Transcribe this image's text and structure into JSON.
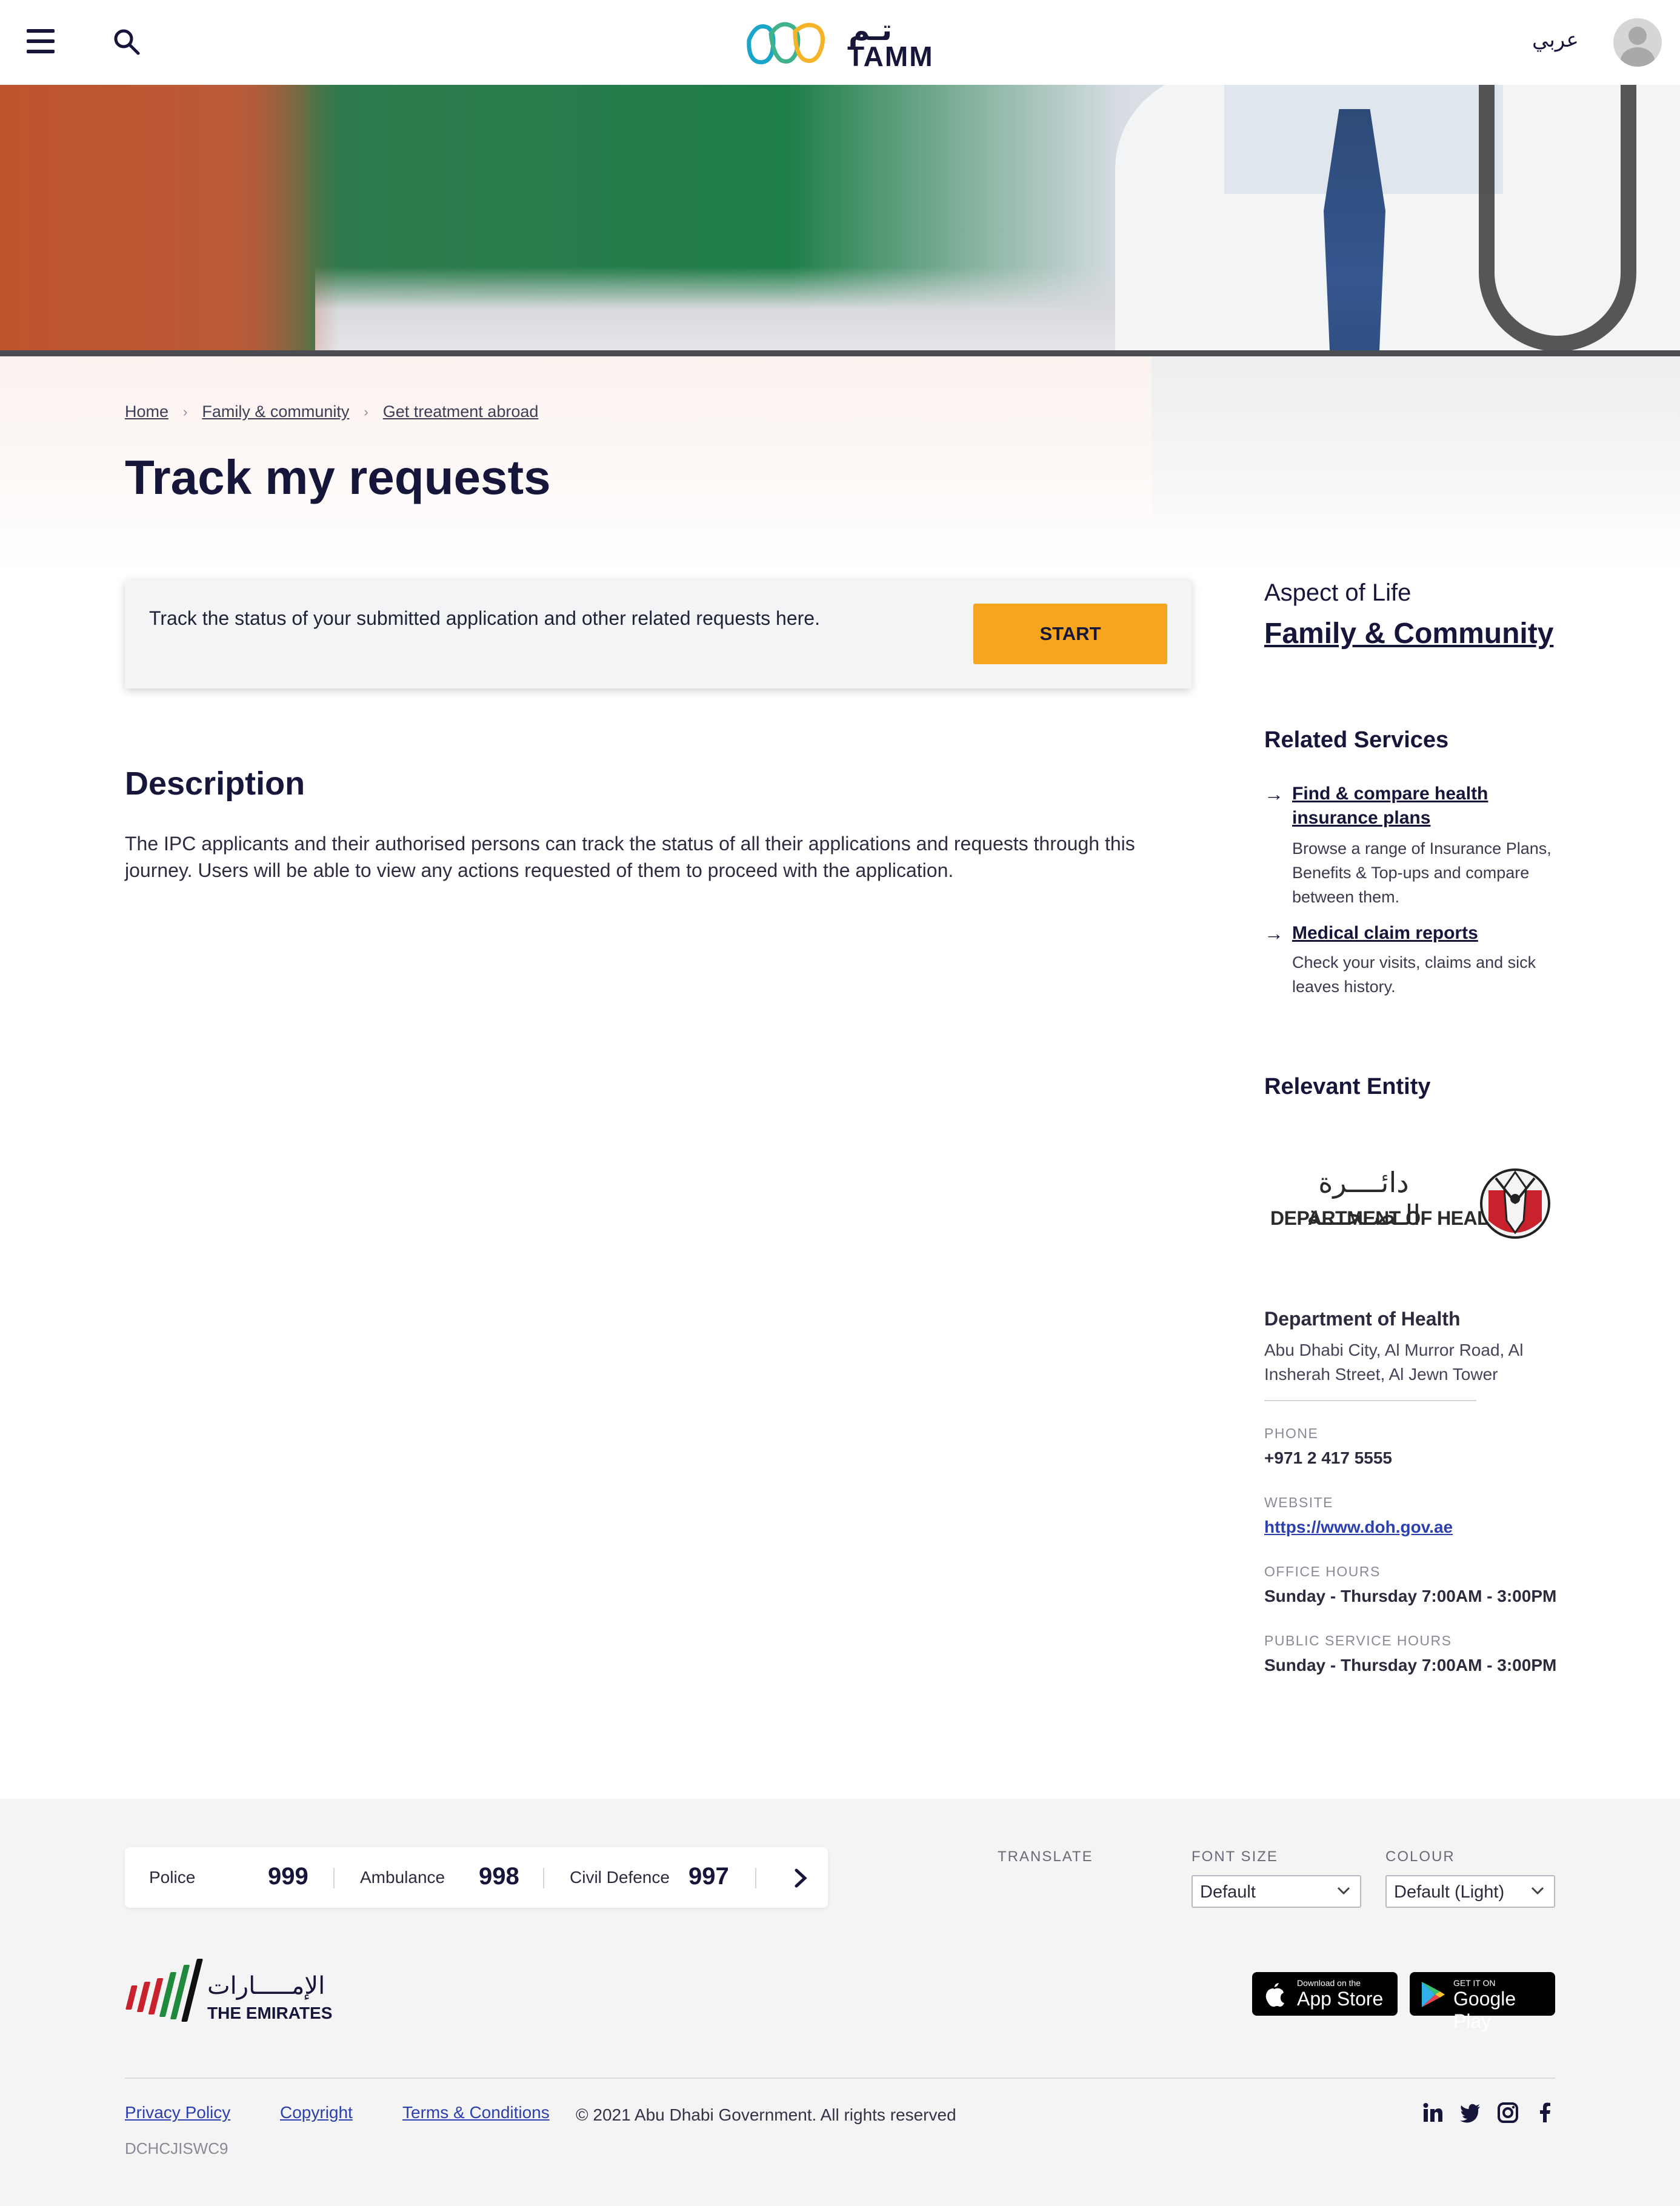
{
  "header": {
    "logo_text": "TAMM",
    "logo_arabic": "تـم",
    "language_link": "عربي"
  },
  "breadcrumb": [
    "Home",
    "Family & community",
    "Get treatment abroad"
  ],
  "page_title": "Track my requests",
  "start_card": {
    "text": "Track the status of your submitted application and other related requests here.",
    "button_label": "START"
  },
  "description": {
    "title": "Description",
    "text": "The IPC applicants and their authorised persons can track the status of all their applications and requests through this journey. Users will be able to view any actions requested of them to proceed with the application."
  },
  "sidebar": {
    "aspect_label": "Aspect of Life",
    "aspect_link": "Family & Community",
    "related_title": "Related Services",
    "related": [
      {
        "title": "Find & compare health insurance plans",
        "desc": "Browse a range of Insurance Plans, Benefits & Top-ups and compare between them."
      },
      {
        "title": "Medical claim reports",
        "desc": "Check your visits, claims and sick leaves history."
      }
    ],
    "entity_title": "Relevant Entity",
    "entity_logo_ar": "دائــــرة الـصـحـــة",
    "entity_logo_en": "DEPARTMENT OF HEALTH",
    "entity_name": "Department of Health",
    "entity_address": "Abu Dhabi City, Al Murror Road, Al Insherah Street, Al Jewn Tower",
    "phone_label": "PHONE",
    "phone": "+971 2 417 5555",
    "website_label": "WEBSITE",
    "website": "https://www.doh.gov.ae",
    "office_label": "OFFICE HOURS",
    "office_hours": "Sunday - Thursday 7:00AM - 3:00PM",
    "public_label": "PUBLIC SERVICE HOURS",
    "public_hours": "Sunday - Thursday 7:00AM - 3:00PM"
  },
  "footer": {
    "emergency": [
      {
        "label": "Police",
        "number": "999"
      },
      {
        "label": "Ambulance",
        "number": "998"
      },
      {
        "label": "Civil Defence",
        "number": "997"
      }
    ],
    "translate_label": "TRANSLATE",
    "font_size_label": "FONT SIZE",
    "font_size_value": "Default",
    "colour_label": "COLOUR",
    "colour_value": "Default (Light)",
    "emirates_ar": "الإمـــــارات",
    "emirates_en": "THE EMIRATES",
    "app_store_small": "Download on the",
    "app_store_big": "App Store",
    "google_small": "GET IT ON",
    "google_big": "Google Play",
    "links": [
      "Privacy Policy",
      "Copyright",
      "Terms & Conditions"
    ],
    "copyright": "© 2021 Abu Dhabi Government. All rights reserved",
    "code": "DCHCJISWC9"
  }
}
